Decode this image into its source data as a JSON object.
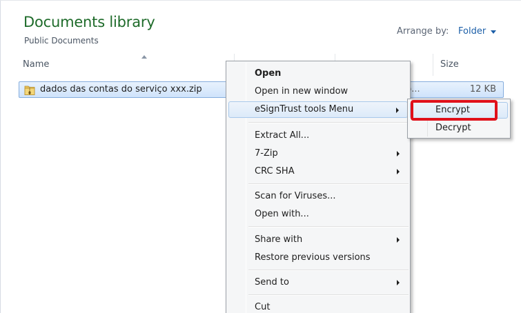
{
  "library": {
    "title": "Documents library",
    "subtitle": "Public Documents",
    "arrange_label": "Arrange by:",
    "arrange_value": "Folder"
  },
  "columns": {
    "name": "Name",
    "size": "Size"
  },
  "file": {
    "name": "dados das contas do serviço xxx.zip",
    "type": "p...",
    "size": "12 KB"
  },
  "context_menu": {
    "open": "Open",
    "open_new_window": "Open in new window",
    "esigntrust": "eSignTrust tools Menu",
    "extract_all": "Extract All...",
    "seven_zip": "7-Zip",
    "crc_sha": "CRC SHA",
    "scan": "Scan for Viruses...",
    "open_with": "Open with...",
    "share_with": "Share with",
    "restore": "Restore previous versions",
    "send_to": "Send to",
    "cut": "Cut"
  },
  "submenu": {
    "encrypt": "Encrypt",
    "decrypt": "Decrypt"
  },
  "colors": {
    "title_green": "#1e6b2a",
    "link_blue": "#1c5fa8",
    "highlight_red": "#e0101a"
  }
}
